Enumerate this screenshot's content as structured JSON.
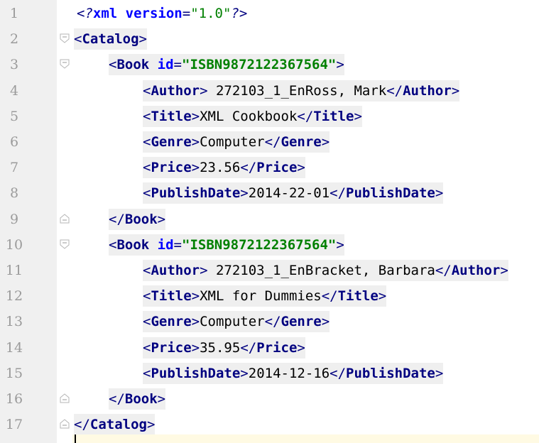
{
  "editor": {
    "lines": [
      {
        "n": "1",
        "segs": [
          [
            "pi",
            "<?"
          ],
          [
            "pi-key",
            "xml version"
          ],
          [
            "pi",
            "="
          ],
          [
            "pi-val",
            "\"1.0\""
          ],
          [
            "pi",
            "?>"
          ]
        ]
      },
      {
        "n": "2",
        "segs": [
          [
            "bracket",
            "<"
          ],
          [
            "tagname",
            "Catalog"
          ],
          [
            "bracket",
            ">"
          ]
        ]
      },
      {
        "n": "3",
        "segs": [
          [
            "bracket",
            "<"
          ],
          [
            "tagname",
            "Book "
          ],
          [
            "attrname",
            "id"
          ],
          [
            "bracket",
            "="
          ],
          [
            "attrval",
            "\"ISBN9872122367564\""
          ],
          [
            "bracket",
            ">"
          ]
        ]
      },
      {
        "n": "4",
        "segs": [
          [
            "bracket",
            "<"
          ],
          [
            "tagname",
            "Author"
          ],
          [
            "bracket",
            ">"
          ],
          [
            "text",
            " 272103_1_EnRoss, Mark"
          ],
          [
            "bracket",
            "</"
          ],
          [
            "tagname",
            "Author"
          ],
          [
            "bracket",
            ">"
          ]
        ]
      },
      {
        "n": "5",
        "segs": [
          [
            "bracket",
            "<"
          ],
          [
            "tagname",
            "Title"
          ],
          [
            "bracket",
            ">"
          ],
          [
            "text",
            "XML Cookbook"
          ],
          [
            "bracket",
            "</"
          ],
          [
            "tagname",
            "Title"
          ],
          [
            "bracket",
            ">"
          ]
        ]
      },
      {
        "n": "6",
        "segs": [
          [
            "bracket",
            "<"
          ],
          [
            "tagname",
            "Genre"
          ],
          [
            "bracket",
            ">"
          ],
          [
            "text",
            "Computer"
          ],
          [
            "bracket",
            "</"
          ],
          [
            "tagname",
            "Genre"
          ],
          [
            "bracket",
            ">"
          ]
        ]
      },
      {
        "n": "7",
        "segs": [
          [
            "bracket",
            "<"
          ],
          [
            "tagname",
            "Price"
          ],
          [
            "bracket",
            ">"
          ],
          [
            "text",
            "23.56"
          ],
          [
            "bracket",
            "</"
          ],
          [
            "tagname",
            "Price"
          ],
          [
            "bracket",
            ">"
          ]
        ]
      },
      {
        "n": "8",
        "segs": [
          [
            "bracket",
            "<"
          ],
          [
            "tagname",
            "PublishDate"
          ],
          [
            "bracket",
            ">"
          ],
          [
            "text",
            "2014-22-01"
          ],
          [
            "bracket",
            "</"
          ],
          [
            "tagname",
            "PublishDate"
          ],
          [
            "bracket",
            ">"
          ]
        ]
      },
      {
        "n": "9",
        "segs": [
          [
            "bracket",
            "</"
          ],
          [
            "tagname",
            "Book"
          ],
          [
            "bracket",
            ">"
          ]
        ]
      },
      {
        "n": "10",
        "segs": [
          [
            "bracket",
            "<"
          ],
          [
            "tagname",
            "Book "
          ],
          [
            "attrname",
            "id"
          ],
          [
            "bracket",
            "="
          ],
          [
            "attrval",
            "\"ISBN9872122367564\""
          ],
          [
            "bracket",
            ">"
          ]
        ]
      },
      {
        "n": "11",
        "segs": [
          [
            "bracket",
            "<"
          ],
          [
            "tagname",
            "Author"
          ],
          [
            "bracket",
            ">"
          ],
          [
            "text",
            " 272103_1_EnBracket, Barbara"
          ],
          [
            "bracket",
            "</"
          ],
          [
            "tagname",
            "Author"
          ],
          [
            "bracket",
            ">"
          ]
        ]
      },
      {
        "n": "12",
        "segs": [
          [
            "bracket",
            "<"
          ],
          [
            "tagname",
            "Title"
          ],
          [
            "bracket",
            ">"
          ],
          [
            "text",
            "XML for Dummies"
          ],
          [
            "bracket",
            "</"
          ],
          [
            "tagname",
            "Title"
          ],
          [
            "bracket",
            ">"
          ]
        ]
      },
      {
        "n": "13",
        "segs": [
          [
            "bracket",
            "<"
          ],
          [
            "tagname",
            "Genre"
          ],
          [
            "bracket",
            ">"
          ],
          [
            "text",
            "Computer"
          ],
          [
            "bracket",
            "</"
          ],
          [
            "tagname",
            "Genre"
          ],
          [
            "bracket",
            ">"
          ]
        ]
      },
      {
        "n": "14",
        "segs": [
          [
            "bracket",
            "<"
          ],
          [
            "tagname",
            "Price"
          ],
          [
            "bracket",
            ">"
          ],
          [
            "text",
            "35.95"
          ],
          [
            "bracket",
            "</"
          ],
          [
            "tagname",
            "Price"
          ],
          [
            "bracket",
            ">"
          ]
        ]
      },
      {
        "n": "15",
        "segs": [
          [
            "bracket",
            "<"
          ],
          [
            "tagname",
            "PublishDate"
          ],
          [
            "bracket",
            ">"
          ],
          [
            "text",
            "2014-12-16"
          ],
          [
            "bracket",
            "</"
          ],
          [
            "tagname",
            "PublishDate"
          ],
          [
            "bracket",
            ">"
          ]
        ]
      },
      {
        "n": "16",
        "segs": [
          [
            "bracket",
            "</"
          ],
          [
            "tagname",
            "Book"
          ],
          [
            "bracket",
            ">"
          ]
        ]
      },
      {
        "n": "17",
        "segs": [
          [
            "bracket",
            "</"
          ],
          [
            "tagname",
            "Catalog"
          ],
          [
            "bracket",
            ">"
          ]
        ]
      }
    ]
  },
  "colors": {
    "tag": "#000080",
    "attr_name": "#0000ff",
    "attr_value": "#008000",
    "text": "#000000",
    "gutter": "#f0f0f0",
    "line_number": "#9b9b9b",
    "current_line": "#fffae3",
    "highlight": "#efefef"
  }
}
